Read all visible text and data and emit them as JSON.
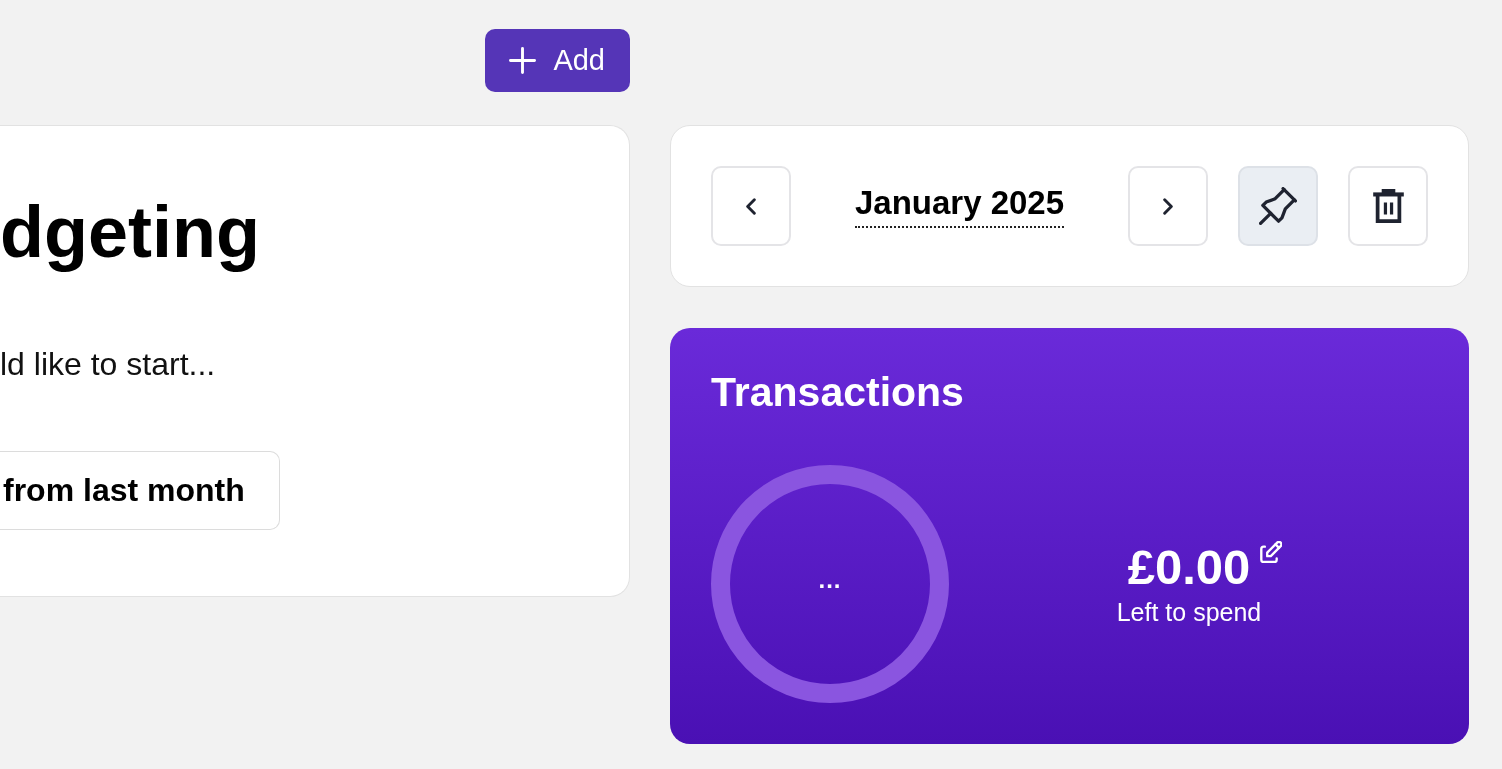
{
  "header": {
    "add_button": {
      "label": "Add"
    }
  },
  "intro_card": {
    "title": "dgeting",
    "text": "ld like to start...",
    "button": {
      "label": "from last month"
    }
  },
  "month_nav": {
    "month": "January 2025",
    "pinned": true
  },
  "transactions_card": {
    "title": "Transactions",
    "ring_label": "...",
    "amount": "£0.00",
    "caption": "Left to spend"
  }
}
